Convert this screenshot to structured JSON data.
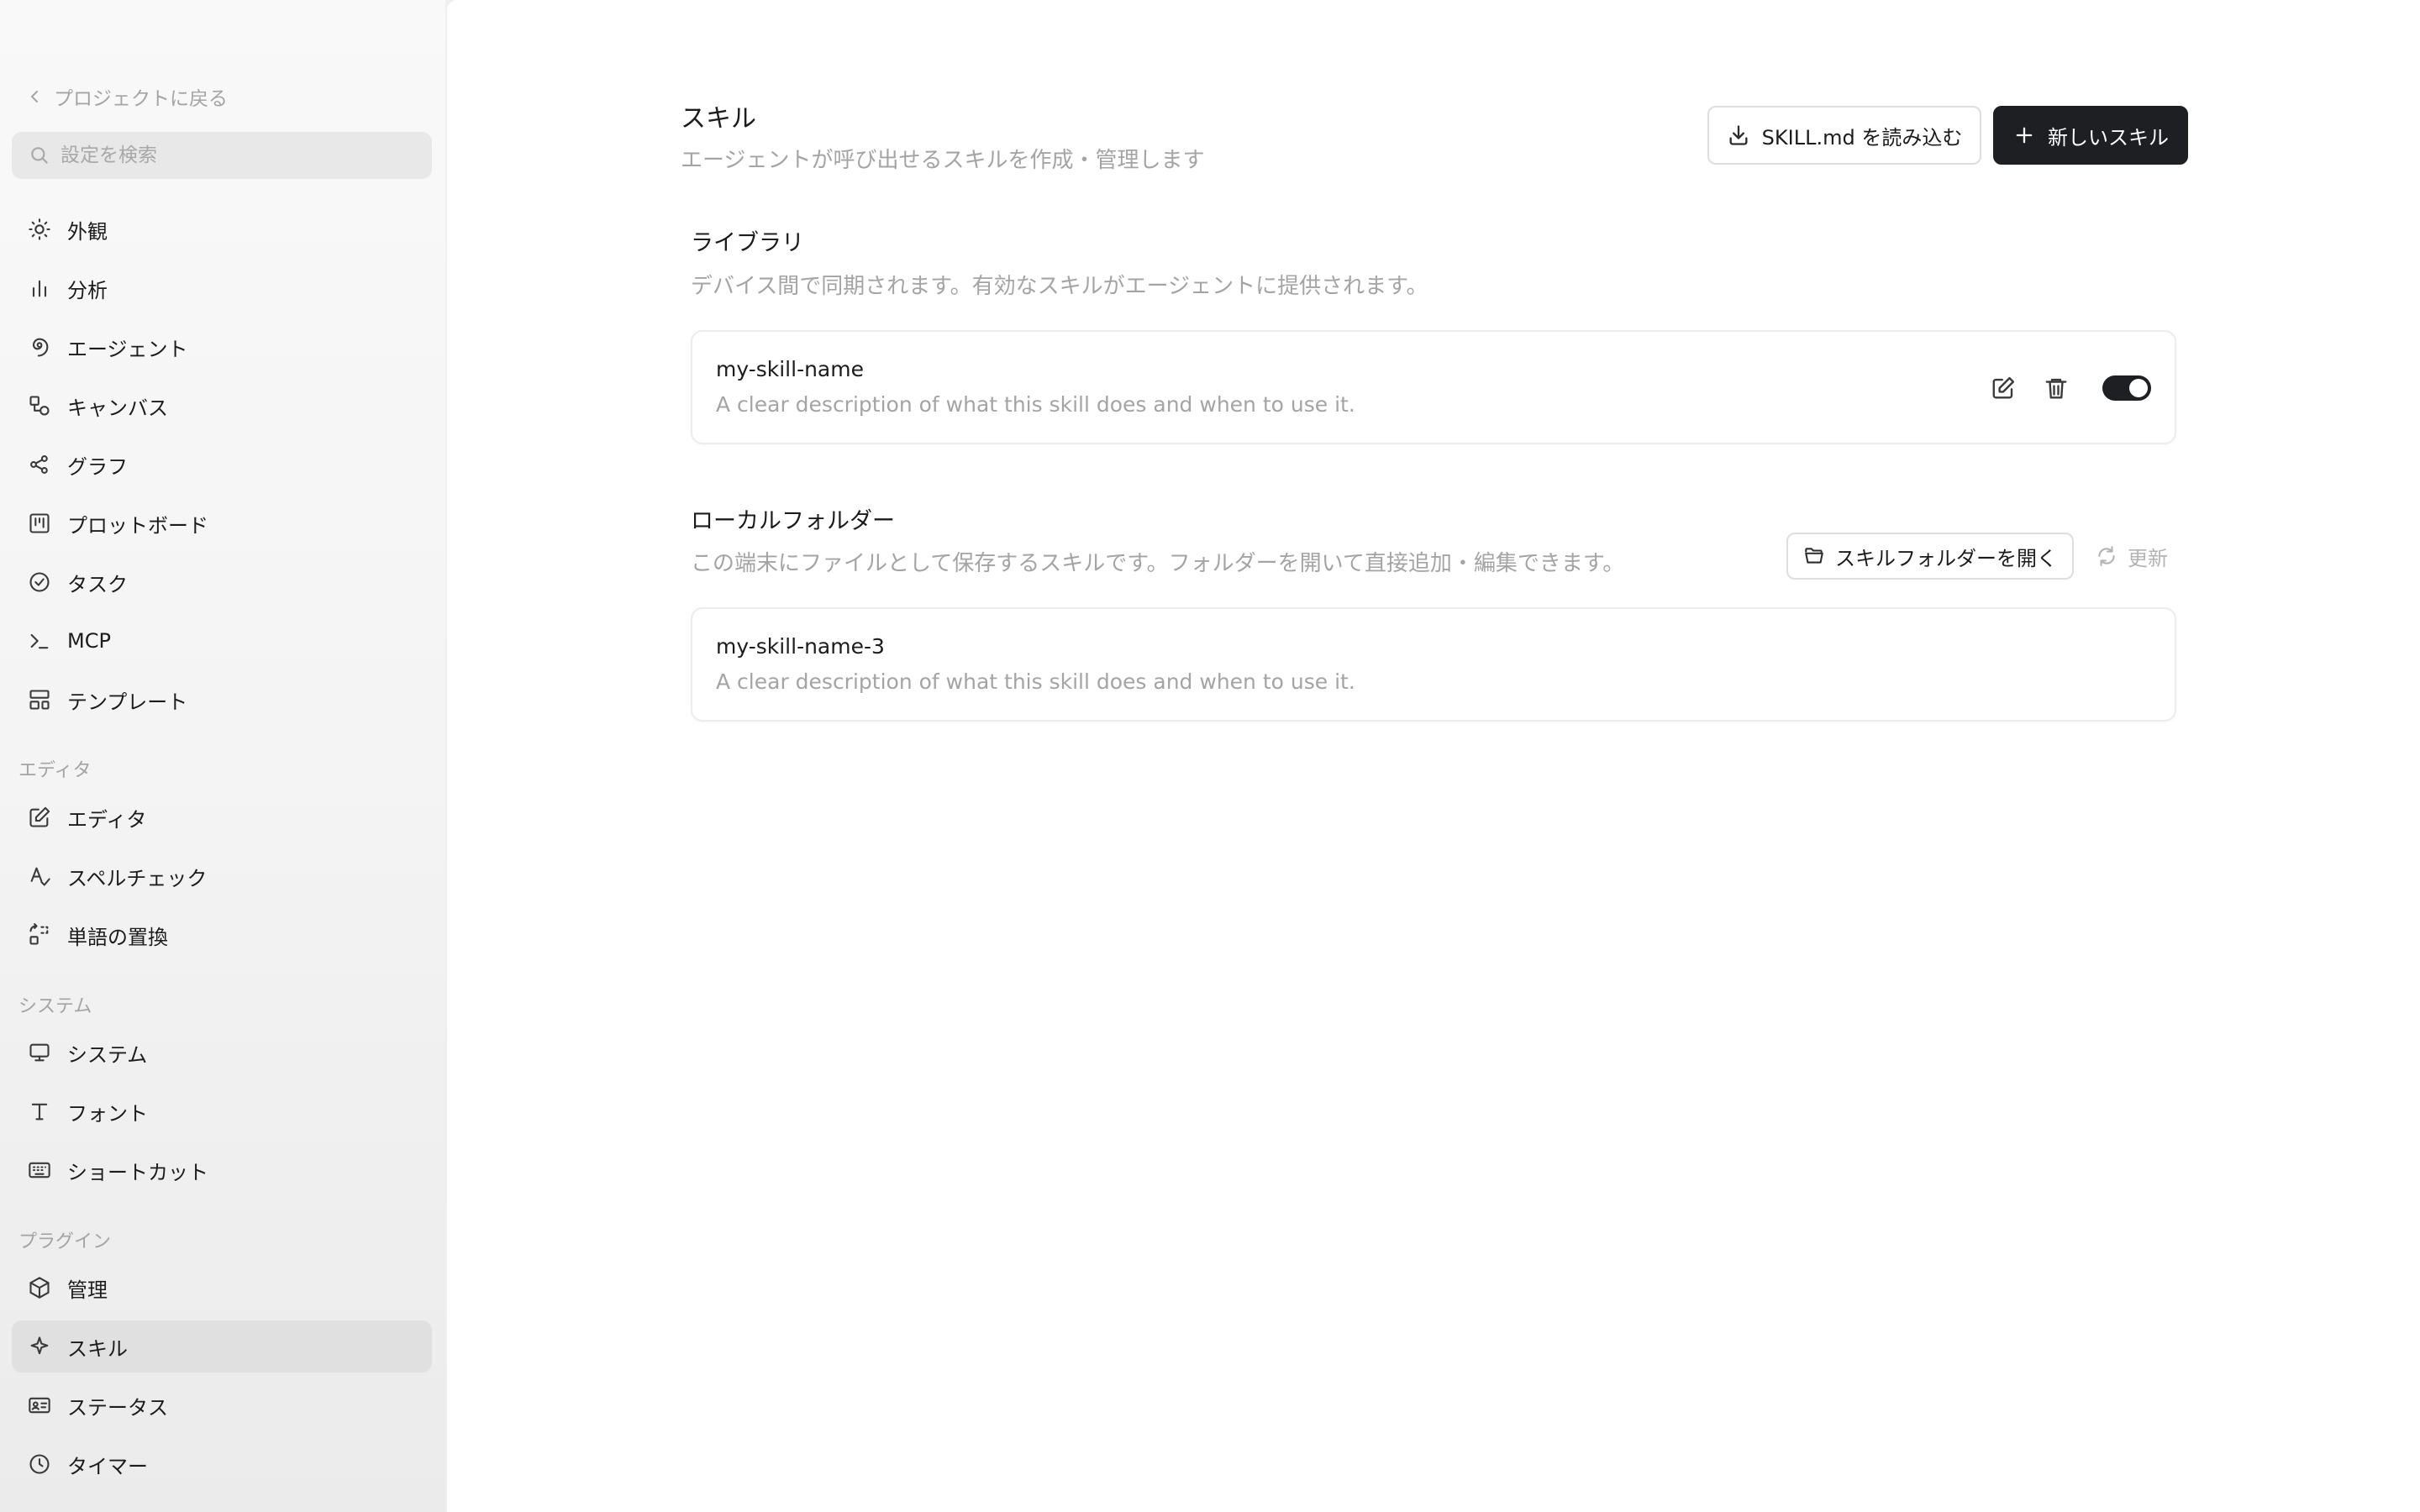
{
  "sidebar": {
    "back_label": "プロジェクトに戻る",
    "search_placeholder": "設定を検索",
    "items": [
      {
        "label": "外観",
        "icon": "sun-icon"
      },
      {
        "label": "分析",
        "icon": "bar-chart-icon"
      },
      {
        "label": "エージェント",
        "icon": "spiral-icon"
      },
      {
        "label": "キャンバス",
        "icon": "shapes-icon"
      },
      {
        "label": "グラフ",
        "icon": "graph-nodes-icon"
      },
      {
        "label": "プロットボード",
        "icon": "board-icon"
      },
      {
        "label": "タスク",
        "icon": "check-circle-icon"
      },
      {
        "label": "MCP",
        "icon": "terminal-icon"
      },
      {
        "label": "テンプレート",
        "icon": "layout-template-icon"
      }
    ],
    "editor_section": {
      "label": "エディタ",
      "items": [
        {
          "label": "エディタ",
          "icon": "pencil-square-icon"
        },
        {
          "label": "スペルチェック",
          "icon": "spell-check-icon"
        },
        {
          "label": "単語の置換",
          "icon": "replace-icon"
        }
      ]
    },
    "system_section": {
      "label": "システム",
      "items": [
        {
          "label": "システム",
          "icon": "monitor-icon"
        },
        {
          "label": "フォント",
          "icon": "type-icon"
        },
        {
          "label": "ショートカット",
          "icon": "keyboard-icon"
        }
      ]
    },
    "plugin_section": {
      "label": "プラグイン",
      "items": [
        {
          "label": "管理",
          "icon": "package-icon"
        },
        {
          "label": "スキル",
          "icon": "sparkle-icon",
          "active": true
        },
        {
          "label": "ステータス",
          "icon": "id-card-icon"
        },
        {
          "label": "タイマー",
          "icon": "clock-icon"
        }
      ]
    }
  },
  "header": {
    "title": "スキル",
    "subtitle": "エージェントが呼び出せるスキルを作成・管理します",
    "import_label": "SKILL.md を読み込む",
    "new_label": "新しいスキル"
  },
  "library": {
    "title": "ライブラリ",
    "description": "デバイス間で同期されます。有効なスキルがエージェントに提供されます。",
    "skills": [
      {
        "name": "my-skill-name",
        "description": "A clear description of what this skill does and when to use it.",
        "enabled": true
      }
    ]
  },
  "local": {
    "title": "ローカルフォルダー",
    "description": "この端末にファイルとして保存するスキルです。フォルダーを開いて直接追加・編集できます。",
    "open_folder_label": "スキルフォルダーを開く",
    "refresh_label": "更新",
    "skills": [
      {
        "name": "my-skill-name-3",
        "description": "A clear description of what this skill does and when to use it."
      }
    ]
  },
  "colors": {
    "accent_dark": "#1e1f22",
    "muted_text": "#a4a4a4",
    "active_item_bg": "#e0e0e0"
  }
}
